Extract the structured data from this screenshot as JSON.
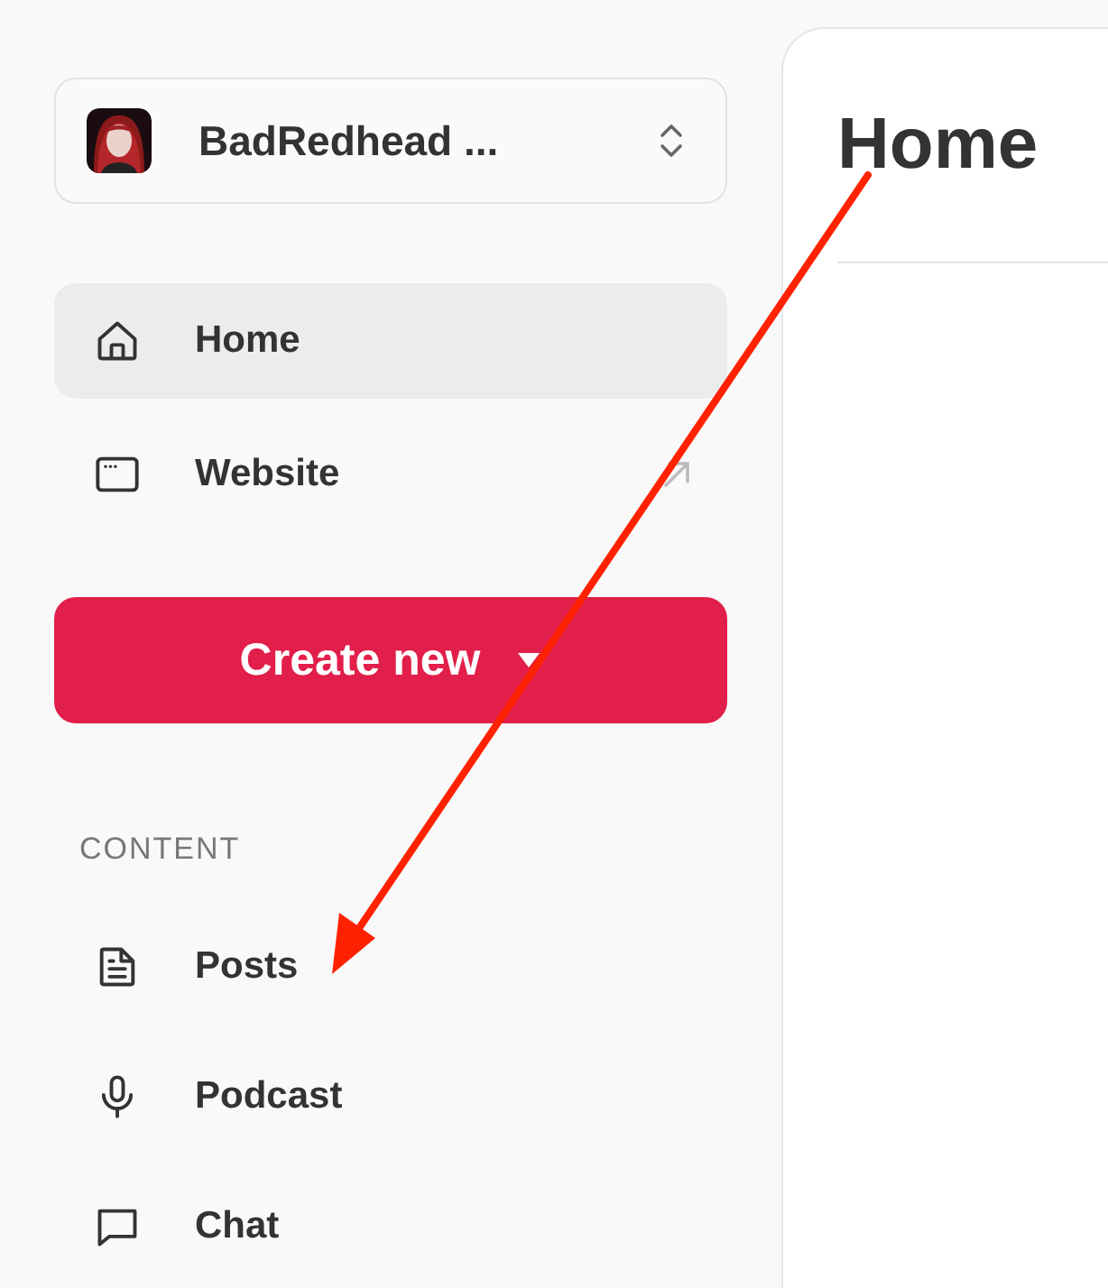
{
  "account": {
    "name": "BadRedhead ..."
  },
  "nav": [
    {
      "kind": "home",
      "label": "Home",
      "selected": true,
      "external": false
    },
    {
      "kind": "website",
      "label": "Website",
      "selected": false,
      "external": true
    }
  ],
  "create_button": {
    "label": "Create new"
  },
  "content_section": {
    "title": "CONTENT",
    "items": [
      {
        "kind": "posts",
        "label": "Posts",
        "selected": false
      },
      {
        "kind": "podcast",
        "label": "Podcast",
        "selected": false
      },
      {
        "kind": "chat",
        "label": "Chat",
        "selected": false
      }
    ]
  },
  "main": {
    "title": "Home"
  }
}
